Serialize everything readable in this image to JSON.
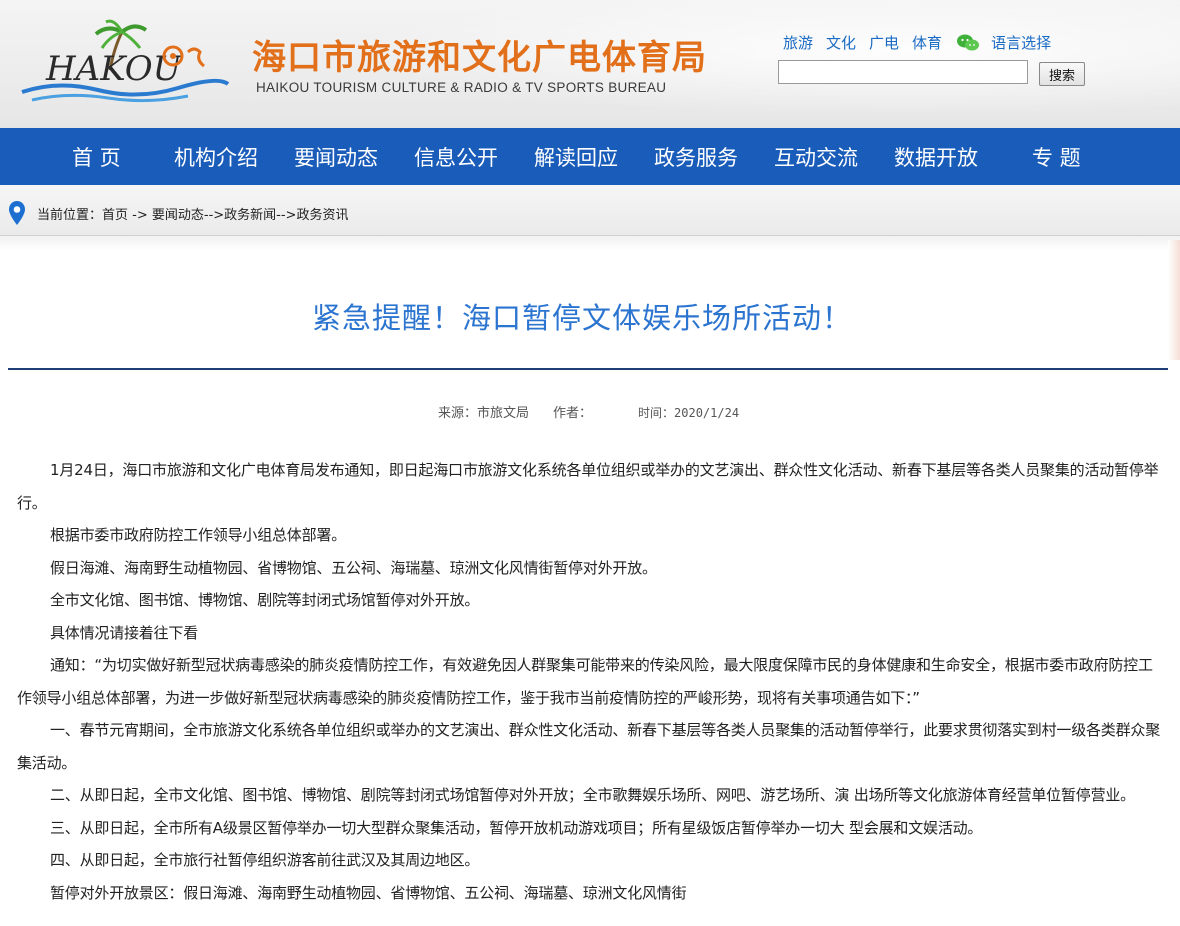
{
  "header": {
    "logo_text": "HAKOU",
    "title_cn": "海口市旅游和文化广电体育局",
    "title_en": "HAIKOU TOURISM CULTURE & RADIO & TV SPORTS BUREAU",
    "links": [
      "旅游",
      "文化",
      "广电",
      "体育"
    ],
    "language": "语言选择",
    "search_placeholder": "",
    "search_button": "搜索"
  },
  "nav": [
    "首 页",
    "机构介绍",
    "要闻动态",
    "信息公开",
    "解读回应",
    "政务服务",
    "互动交流",
    "数据开放",
    "专 题"
  ],
  "breadcrumb": {
    "prefix": "当前位置：",
    "home": "首页",
    "sep1": " -> ",
    "path": "要闻动态-->政务新闻-->政务资讯"
  },
  "article": {
    "title": "紧急提醒！海口暂停文体娱乐场所活动！",
    "source": "来源：市旅文局",
    "author": "作者：",
    "time": "时间：2020/1/24",
    "paragraphs": [
      "1月24日，海口市旅游和文化广电体育局发布通知，即日起海口市旅游文化系统各单位组织或举办的文艺演出、群众性文化活动、新春下基层等各类人员聚集的活动暂停举行。",
      "根据市委市政府防控工作领导小组总体部署。",
      "假日海滩、海南野生动植物园、省博物馆、五公祠、海瑞墓、琼洲文化风情街暂停对外开放。",
      "全市文化馆、图书馆、博物馆、剧院等封闭式场馆暂停对外开放。",
      "具体情况请接着往下看",
      "通知：“为切实做好新型冠状病毒感染的肺炎疫情防控工作，有效避免因人群聚集可能带来的传染风险，最大限度保障市民的身体健康和生命安全，根据市委市政府防控工作领导小组总体部署，为进一步做好新型冠状病毒感染的肺炎疫情防控工作，鉴于我市当前疫情防控的严峻形势，现将有关事项通告如下：”",
      "一、春节元宵期间，全市旅游文化系统各单位组织或举办的文艺演出、群众性文化活动、新春下基层等各类人员聚集的活动暂停举行，此要求贯彻落实到村一级各类群众聚集活动。",
      "二、从即日起，全市文化馆、图书馆、博物馆、剧院等封闭式场馆暂停对外开放；全市歌舞娱乐场所、网吧、游艺场所、演 出场所等文化旅游体育经营单位暂停营业。",
      "三、从即日起，全市所有A级景区暂停举办一切大型群众聚集活动，暂停开放机动游戏项目；所有星级饭店暂停举办一切大 型会展和文娱活动。",
      "四、从即日起，全市旅行社暂停组织游客前往武汉及其周边地区。",
      "暂停对外开放景区：假日海滩、海南野生动植物园、省博物馆、五公祠、海瑞墓、琼洲文化风情街"
    ]
  },
  "colors": {
    "nav_bg": "#1a5cb9",
    "title_orange": "#e2701b",
    "article_title": "#2b74d0",
    "link_blue": "#1a6bc4",
    "rule": "#1e3e78"
  }
}
